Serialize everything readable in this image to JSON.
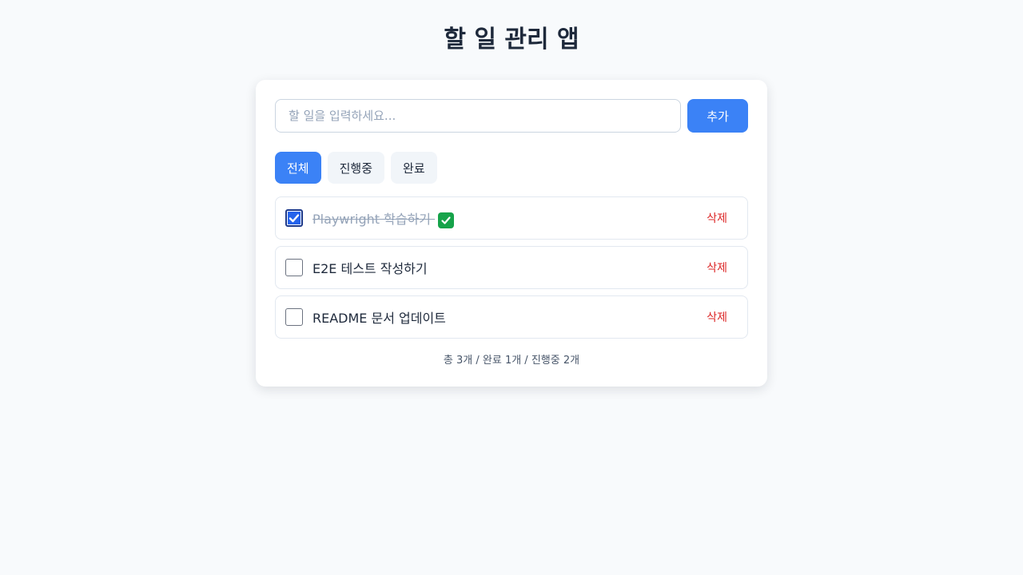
{
  "app": {
    "title": "할 일 관리 앱"
  },
  "input": {
    "placeholder": "할 일을 입력하세요...",
    "value": "",
    "add_label": "추가"
  },
  "filters": [
    {
      "label": "전체",
      "active": true
    },
    {
      "label": "진행중",
      "active": false
    },
    {
      "label": "완료",
      "active": false
    }
  ],
  "todos": [
    {
      "text": "Playwright 학습하기",
      "done": true,
      "delete_label": "삭제"
    },
    {
      "text": "E2E 테스트 작성하기",
      "done": false,
      "delete_label": "삭제"
    },
    {
      "text": "README 문서 업데이트",
      "done": false,
      "delete_label": "삭제"
    }
  ],
  "summary": "총 3개 / 완료 1개 / 진행중 2개",
  "colors": {
    "accent": "#3b82f6",
    "delete": "#dc2626",
    "done_text": "#94a3b8",
    "background": "#f8fafc"
  },
  "icons": {
    "done_emoji": "check-mark-button-icon"
  }
}
